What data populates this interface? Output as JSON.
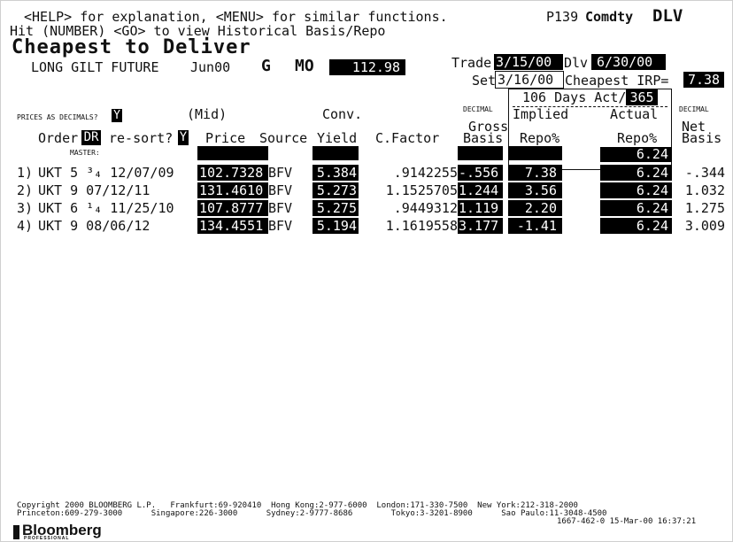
{
  "header": {
    "help_line": "<HELP> for explanation, <MENU> for similar functions.",
    "page_code": "P139",
    "market": "Comdty",
    "function_code": "DLV",
    "history_line": "Hit (NUMBER) <GO> to view Historical Basis/Repo",
    "title": "Cheapest to Deliver",
    "future_name": "LONG GILT FUTURE",
    "contract": "Jun00",
    "ticker": "G",
    "ticker_suffix": "MO",
    "future_price": "112.98"
  },
  "dates": {
    "trade_label": "Trade",
    "trade_value": "3/15/00",
    "dlv_label": "Dlv",
    "dlv_value": "6/30/00",
    "set_label": "Set",
    "set_value": "3/16/00",
    "cheapest_irp_label": "Cheapest IRP=",
    "cheapest_irp_value": "7.38",
    "days_label": "106 Days Act/",
    "day_count": "365"
  },
  "controls": {
    "prices_as_decimals_label": "PRICES AS DECIMALS?",
    "prices_as_decimals_value": "Y",
    "order_label": "Order",
    "order_value": "DR",
    "resort_label": "re-sort?",
    "resort_value": "Y",
    "master_label": "MASTER:"
  },
  "columns": {
    "mid_label": "(Mid)",
    "price": "Price",
    "source": "Source",
    "conv_label": "Conv.",
    "yield": "Yield",
    "cfactor": "C.Factor",
    "gross_decimal": "DECIMAL",
    "gross": "Gross",
    "gross_basis": "Basis",
    "implied": "Implied",
    "implied_repo": "Repo%",
    "actual": "Actual",
    "actual_repo": "Repo%",
    "net_decimal": "DECIMAL",
    "net": "Net",
    "net_basis": "Basis"
  },
  "master_actual_repo": "6.24",
  "bonds": [
    {
      "num": "1)",
      "name": "UKT 5 ³₄ 12/07/09",
      "price": "102.7328",
      "source": "BFV",
      "yield": "5.384",
      "cfactor": ".9142255",
      "gross_basis": "-.556",
      "implied_repo": "7.38",
      "actual_repo": "6.24",
      "net_basis": "-.344"
    },
    {
      "num": "2)",
      "name": "UKT 9 07/12/11",
      "price": "131.4610",
      "source": "BFV",
      "yield": "5.273",
      "cfactor": "1.1525705",
      "gross_basis": "1.244",
      "implied_repo": "3.56",
      "actual_repo": "6.24",
      "net_basis": "1.032"
    },
    {
      "num": "3)",
      "name": "UKT 6 ¹₄ 11/25/10",
      "price": "107.8777",
      "source": "BFV",
      "yield": "5.275",
      "cfactor": ".9449312",
      "gross_basis": "1.119",
      "implied_repo": "2.20",
      "actual_repo": "6.24",
      "net_basis": "1.275"
    },
    {
      "num": "4)",
      "name": "UKT 9 08/06/12",
      "price": "134.4551",
      "source": "BFV",
      "yield": "5.194",
      "cfactor": "1.1619558",
      "gross_basis": "3.177",
      "implied_repo": "-1.41",
      "actual_repo": "6.24",
      "net_basis": "3.009"
    }
  ],
  "footer": {
    "copyright_line": "Copyright 2000 BLOOMBERG L.P.   Frankfurt:69-920410  Hong Kong:2-977-6000  London:171-330-7500  New York:212-318-2000",
    "offices_line": "Princeton:609-279-3000      Singapore:226-3000      Sydney:2-9777-8686        Tokyo:3-3201-8900      Sao Paulo:11-3048-4500",
    "stamp_line": "1667-462-0 15-Mar-00 16:37:21",
    "logo_text": "Bloomberg",
    "logo_sub": "PROFESSIONAL"
  }
}
